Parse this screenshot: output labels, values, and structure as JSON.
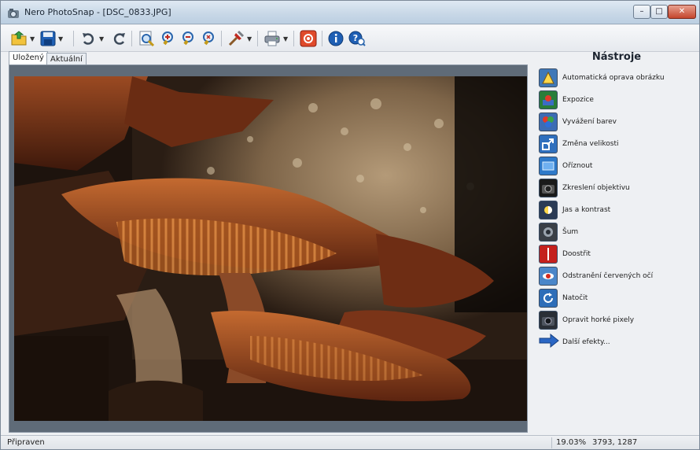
{
  "window": {
    "title": "Nero PhotoSnap - [DSC_0833.JPG]",
    "minimize_label": "–",
    "maximize_label": "□",
    "close_label": "✕"
  },
  "toolbar": {
    "icons": [
      "open-icon",
      "save-icon",
      "undo-icon",
      "redo-icon",
      "fit-icon",
      "zoom-in-icon",
      "zoom-out-icon",
      "zoom-actual-icon",
      "tools-icon",
      "print-icon",
      "settings-icon",
      "info-icon",
      "help-icon"
    ]
  },
  "tabs": [
    {
      "label": "Uložený",
      "active": true
    },
    {
      "label": "Aktuální",
      "active": false
    }
  ],
  "tools": {
    "title": "Nástroje",
    "items": [
      {
        "label": "Automatická oprava obrázku",
        "icon": "auto-fix-icon",
        "color": "#3f78b8"
      },
      {
        "label": "Expozice",
        "icon": "exposure-icon",
        "color": "#2a7d3a"
      },
      {
        "label": "Vyvážení barev",
        "icon": "color-balance-icon",
        "color": "#3c6cb4"
      },
      {
        "label": "Změna velikosti",
        "icon": "resize-icon",
        "color": "#2f6fbd"
      },
      {
        "label": "Oříznout",
        "icon": "crop-icon",
        "color": "#2e79c9"
      },
      {
        "label": "Zkreslení objektivu",
        "icon": "lens-distortion-icon",
        "color": "#1a1a1a"
      },
      {
        "label": "Jas a kontrast",
        "icon": "brightness-contrast-icon",
        "color": "#2a3b55"
      },
      {
        "label": "Šum",
        "icon": "noise-icon",
        "color": "#3a3f46"
      },
      {
        "label": "Doostřit",
        "icon": "sharpen-icon",
        "color": "#c4201d"
      },
      {
        "label": "Odstranění červených očí",
        "icon": "red-eye-icon",
        "color": "#4a86c9"
      },
      {
        "label": "Natočit",
        "icon": "rotate-icon",
        "color": "#2d6db8"
      },
      {
        "label": "Opravit horké pixely",
        "icon": "hot-pixel-icon",
        "color": "#2a2f36"
      },
      {
        "label": "Další efekty...",
        "icon": "more-effects-arrow-icon",
        "color": "#2a66c4"
      }
    ]
  },
  "status": {
    "text": "Připraven",
    "zoom": "19.03%",
    "coords": "3793, 1287"
  }
}
